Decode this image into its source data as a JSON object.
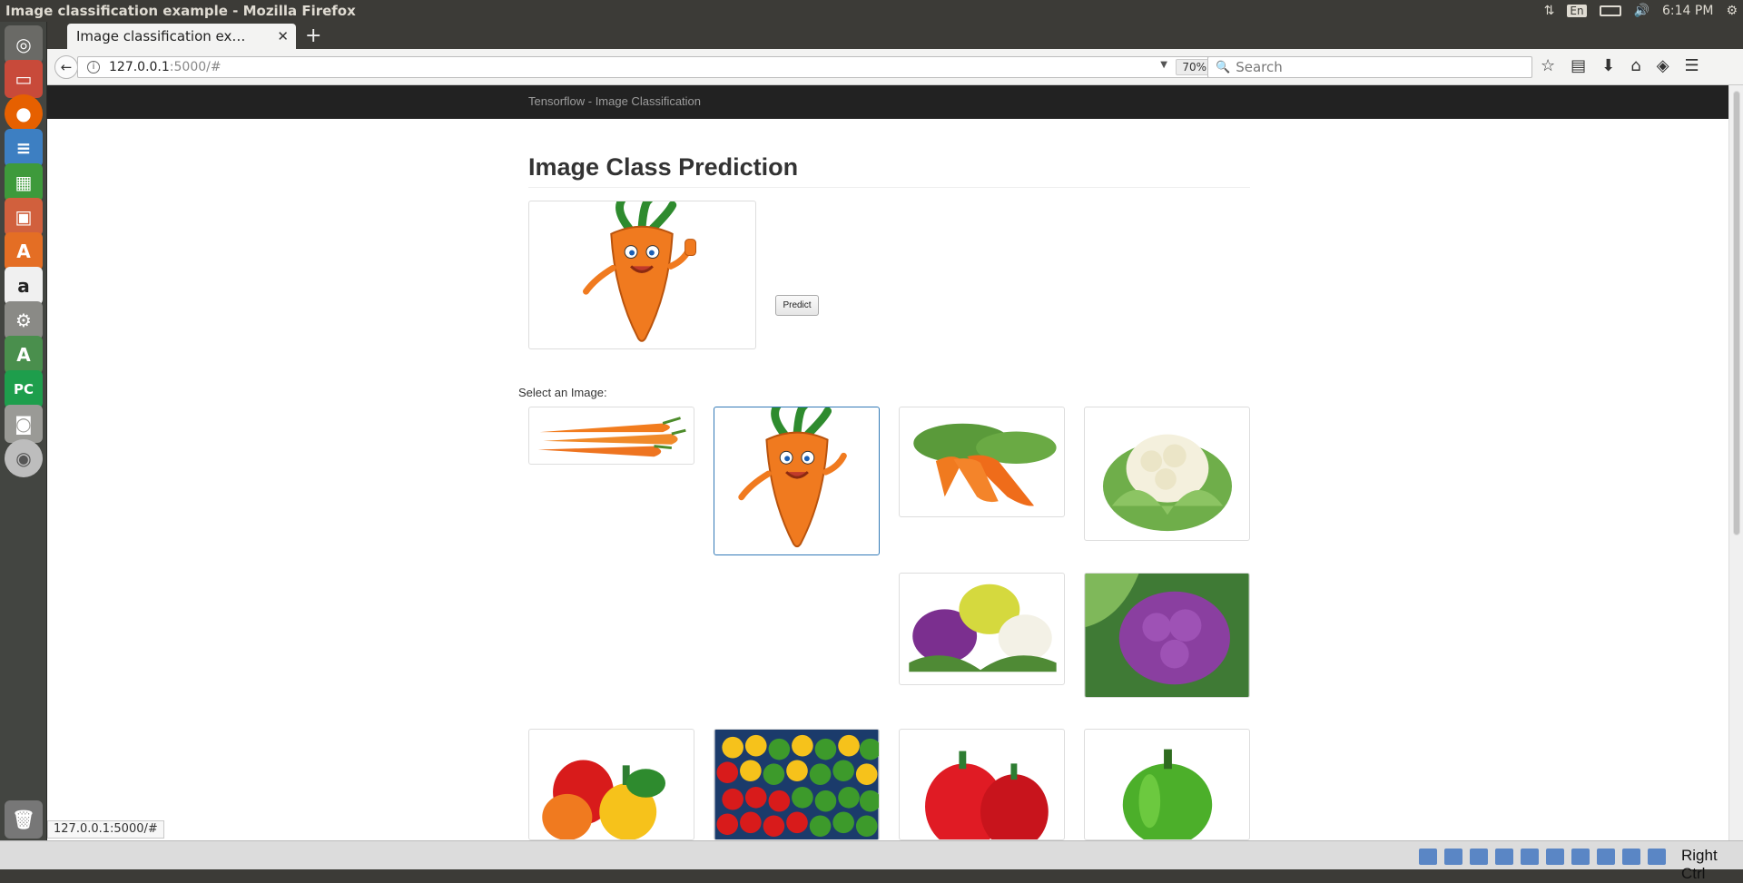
{
  "top_panel": {
    "window_title": "Image classification example - Mozilla Firefox",
    "keyboard": "En",
    "clock": "6:14 PM"
  },
  "browser": {
    "tab_title": "Image classification ex…",
    "url_host": "127.0.0.1",
    "url_rest": ":5000/#",
    "zoom": "70%",
    "search_placeholder": "Search",
    "status_url": "127.0.0.1:5000/#"
  },
  "page": {
    "brand": "Tensorflow - Image Classification",
    "title": "Image Class Prediction",
    "predict_label": "Predict",
    "select_label": "Select an Image:"
  },
  "gallery": [
    {
      "name": "carrots-bunch",
      "selected": false
    },
    {
      "name": "cartoon-carrot",
      "selected": true
    },
    {
      "name": "carrots-with-tops",
      "selected": false
    },
    {
      "name": "white-cauliflower",
      "selected": false
    },
    {
      "name": "mixed-cauliflower",
      "selected": false
    },
    {
      "name": "purple-cauliflower",
      "selected": false
    },
    {
      "name": "bell-peppers-mixed",
      "selected": false
    },
    {
      "name": "peppers-market",
      "selected": false
    },
    {
      "name": "red-peppers",
      "selected": false
    },
    {
      "name": "green-pepper",
      "selected": false
    }
  ],
  "vm_host_key": "Right Ctrl"
}
